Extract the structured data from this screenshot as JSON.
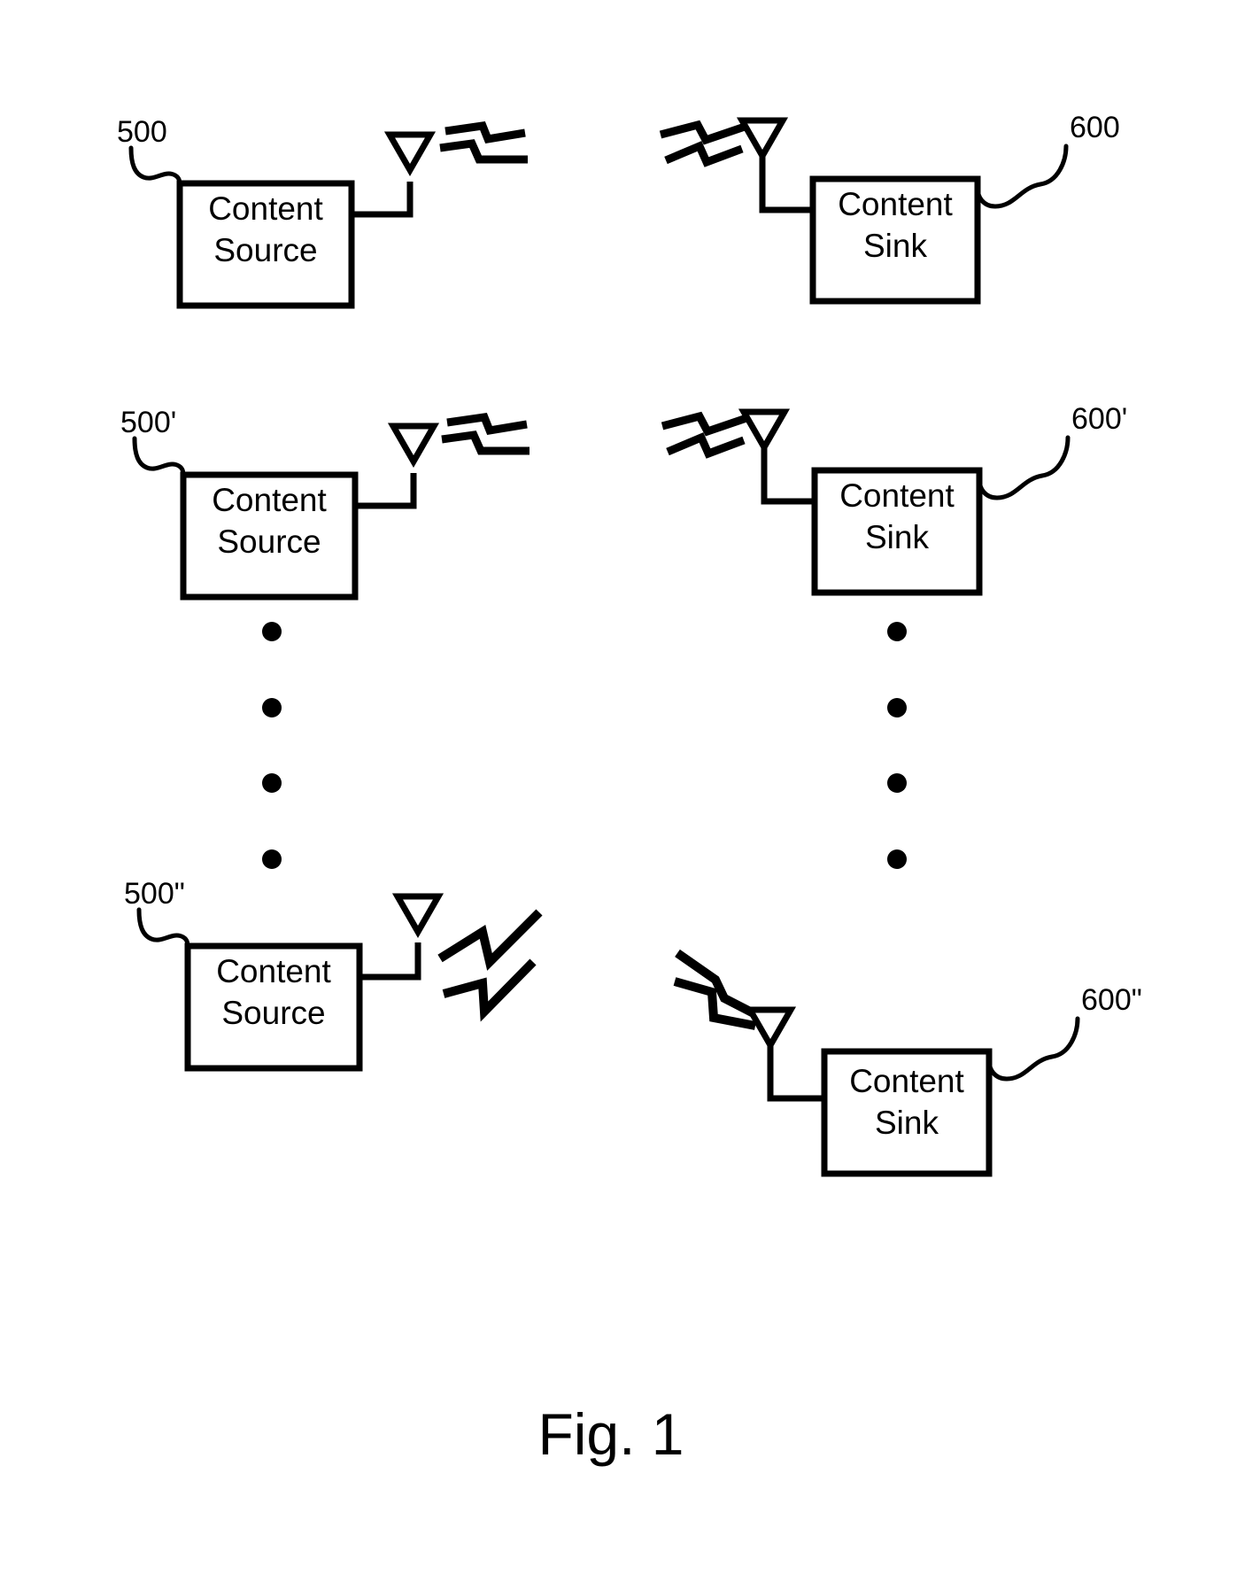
{
  "figure": {
    "caption": "Fig. 1",
    "background_color": "#ffffff",
    "line_color": "#000000"
  },
  "rows": [
    {
      "id": "row-top",
      "source": {
        "label_line1": "Content",
        "label_line2": "Source",
        "reference": "500",
        "antenna": "transmit-antenna-icon",
        "waves": "radio-wave-outgoing-icon"
      },
      "sink": {
        "label_line1": "Content",
        "label_line2": "Sink",
        "reference": "600",
        "antenna": "receive-antenna-icon",
        "waves": "radio-wave-incoming-icon"
      }
    },
    {
      "id": "row-middle",
      "source": {
        "label_line1": "Content",
        "label_line2": "Source",
        "reference": "500'",
        "antenna": "transmit-antenna-icon",
        "waves": "radio-wave-outgoing-icon"
      },
      "sink": {
        "label_line1": "Content",
        "label_line2": "Sink",
        "reference": "600'",
        "antenna": "receive-antenna-icon",
        "waves": "radio-wave-incoming-icon"
      }
    },
    {
      "id": "row-bottom",
      "source": {
        "label_line1": "Content",
        "label_line2": "Source",
        "reference": "500\"",
        "antenna": "transmit-antenna-icon",
        "waves": "radio-wave-outgoing-large-icon"
      },
      "sink": {
        "label_line1": "Content",
        "label_line2": "Sink",
        "reference": "600\"",
        "antenna": "receive-antenna-icon",
        "waves": "radio-wave-incoming-large-icon"
      }
    }
  ],
  "ellipsis": {
    "left_column_dots": 4,
    "right_column_dots": 4,
    "meaning": "vertical-ellipsis"
  }
}
